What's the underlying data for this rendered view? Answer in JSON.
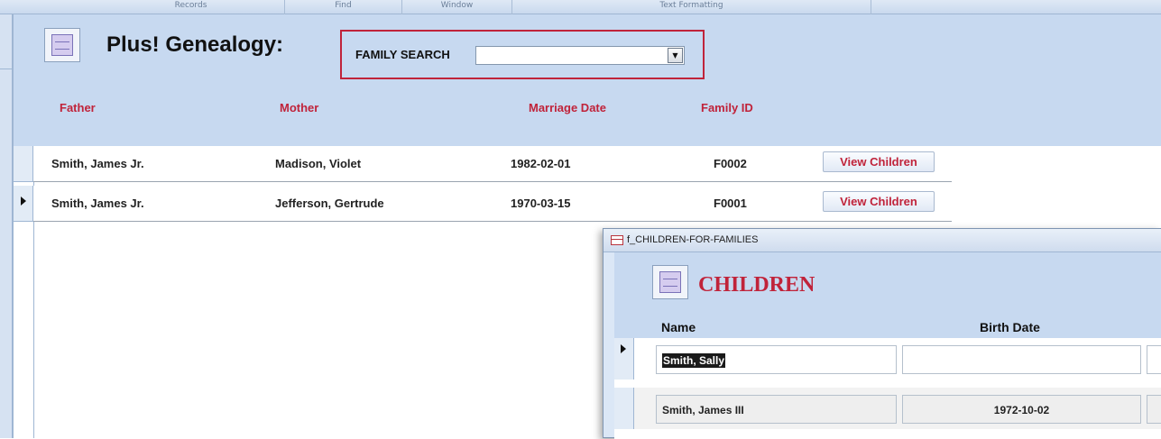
{
  "ribbon": {
    "groups": [
      "Records",
      "Find",
      "Window",
      "Text Formatting"
    ]
  },
  "main": {
    "app_title": "Plus! Genealogy:",
    "search": {
      "label": "FAMILY SEARCH",
      "value": ""
    },
    "columns": {
      "father": "Father",
      "mother": "Mother",
      "marriage_date": "Marriage Date",
      "family_id": "Family ID"
    },
    "rows": [
      {
        "father": "Smith, James Jr.",
        "mother": "Madison, Violet",
        "marriage_date": "1982-02-01",
        "family_id": "F0002",
        "button": "View Children"
      },
      {
        "father": "Smith, James Jr.",
        "mother": "Jefferson, Gertrude",
        "marriage_date": "1970-03-15",
        "family_id": "F0001",
        "button": "View Children"
      }
    ]
  },
  "child_window": {
    "title": "f_CHILDREN-FOR-FAMILIES",
    "heading": "CHILDREN",
    "columns": {
      "name": "Name",
      "birth_date": "Birth Date"
    },
    "rows": [
      {
        "name": "Smith, Sally",
        "birth_date": ""
      },
      {
        "name": "Smith, James III",
        "birth_date": "1972-10-02"
      }
    ]
  },
  "colors": {
    "header_bg": "#c7d9f0",
    "accent_red": "#c0233a"
  },
  "icons": [
    "family-tree-icon",
    "dropdown-arrow-icon",
    "record-selector-icon",
    "form-icon"
  ]
}
